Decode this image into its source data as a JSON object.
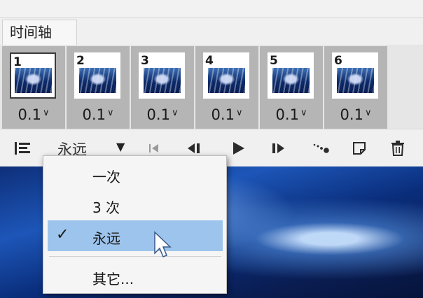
{
  "panel": {
    "tab_label": "时间轴"
  },
  "frames": [
    {
      "number": "1",
      "delay": "0.1",
      "selected": true
    },
    {
      "number": "2",
      "delay": "0.1",
      "selected": false
    },
    {
      "number": "3",
      "delay": "0.1",
      "selected": false
    },
    {
      "number": "4",
      "delay": "0.1",
      "selected": false
    },
    {
      "number": "5",
      "delay": "0.1",
      "selected": false
    },
    {
      "number": "6",
      "delay": "0.1",
      "selected": false
    }
  ],
  "delay_chevron": "∨",
  "toolbar": {
    "loop_value": "永远",
    "loop_arrow": "▼",
    "icons": [
      "convert-timeline-icon",
      "first-frame-icon",
      "previous-frame-icon",
      "play-icon",
      "next-frame-icon",
      "tween-icon",
      "duplicate-frame-icon",
      "delete-frame-icon"
    ]
  },
  "loop_menu": {
    "options": [
      {
        "label": "一次",
        "checked": false
      },
      {
        "label": "3 次",
        "checked": false
      },
      {
        "label": "永远",
        "checked": true
      },
      {
        "label": "其它...",
        "checked": false
      }
    ],
    "check_glyph": "✓"
  },
  "colors": {
    "highlight": "#9dc4ec",
    "frame_bg": "#b5b5b5",
    "panel_bg": "#f0f0f0"
  }
}
